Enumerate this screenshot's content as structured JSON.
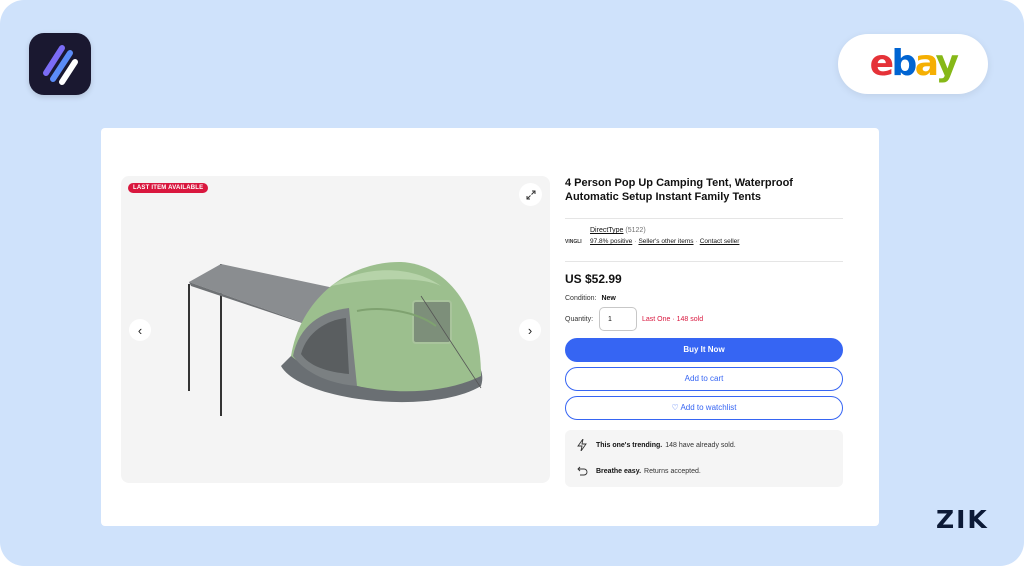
{
  "branding": {
    "app_logo": "zik-analytics-app-icon",
    "marketplace": {
      "letters": [
        "e",
        "b",
        "a",
        "y"
      ],
      "colors": [
        "#e53238",
        "#0064d2",
        "#f5af02",
        "#86b817"
      ]
    },
    "watermark": "ZIK"
  },
  "listing": {
    "badge": "LAST ITEM AVAILABLE",
    "title": "4 Person Pop Up Camping Tent, Waterproof Automatic Setup Instant Family Tents",
    "seller": {
      "logo_text": "VINGLI",
      "name": "DirectType",
      "feedback_count": "(5122)",
      "positive": "97.8% positive",
      "other_items": "Seller's other items",
      "contact": "Contact seller"
    },
    "price": "US $52.99",
    "condition_label": "Condition:",
    "condition_value": "New",
    "quantity_label": "Quantity:",
    "quantity_value": "1",
    "stock_note": "Last One · 148 sold",
    "buttons": {
      "buy_now": "Buy It Now",
      "add_to_cart": "Add to cart",
      "watchlist": "♡ Add to watchlist"
    },
    "info": [
      {
        "icon": "lightning-icon",
        "bold": "This one's trending.",
        "text": "148 have already sold."
      },
      {
        "icon": "return-arrow-icon",
        "bold": "Breathe easy.",
        "text": "Returns accepted."
      }
    ]
  },
  "icons": {
    "expand": "expand-icon",
    "prev": "chevron-left-icon",
    "next": "chevron-right-icon"
  },
  "colors": {
    "accent_blue": "#3665f3",
    "alert_red": "#d9173e",
    "background": "#cfe2fb"
  }
}
